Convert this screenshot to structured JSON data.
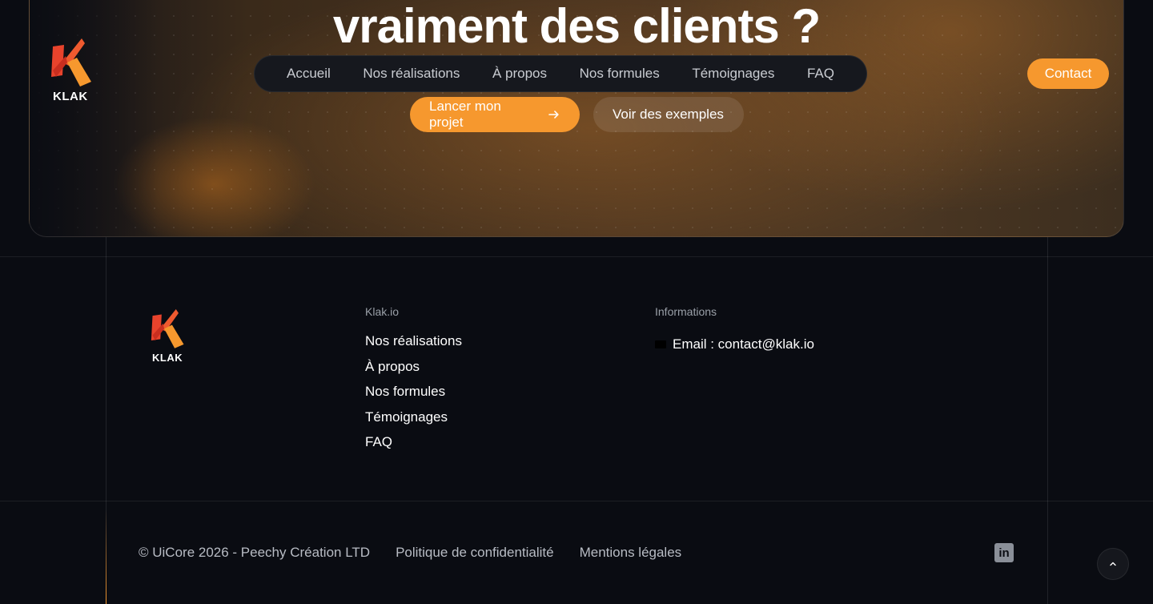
{
  "hero": {
    "title": "vraiment des clients ?",
    "primary_cta": "Lancer mon projet",
    "secondary_cta": "Voir des exemples"
  },
  "header": {
    "logo_text": "KLAK",
    "nav": [
      "Accueil",
      "Nos réalisations",
      "À propos",
      "Nos formules",
      "Témoignages",
      "FAQ"
    ],
    "contact_label": "Contact"
  },
  "footer": {
    "logo_text": "KLAK",
    "col1_title": "Klak.io",
    "col1_links": [
      "Nos réalisations",
      "À propos",
      "Nos formules",
      "Témoignages",
      "FAQ"
    ],
    "col2_title": "Informations",
    "email": "Email : contact@klak.io",
    "copyright": "© UiCore 2026 - Peechy Création LTD",
    "privacy": "Politique de confidentialité",
    "legal": "Mentions légales",
    "linkedin_label": "in"
  },
  "colors": {
    "accent": "#f6982e",
    "background": "#0a0c12"
  },
  "icons": [
    "arrow-right-icon",
    "mail-icon",
    "linkedin-icon",
    "chevron-up-icon"
  ]
}
